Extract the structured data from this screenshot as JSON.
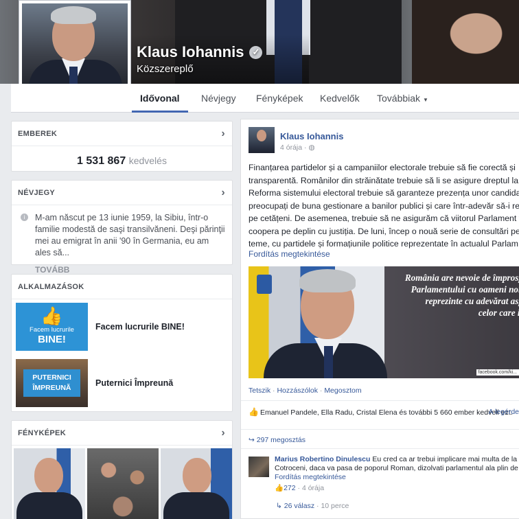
{
  "page": {
    "name": "Klaus Iohannis",
    "category": "Közszereplő"
  },
  "tabs": [
    {
      "label": "Idővonal"
    },
    {
      "label": "Névjegy"
    },
    {
      "label": "Fényképek"
    },
    {
      "label": "Kedvelők"
    },
    {
      "label": "Továbbiak"
    }
  ],
  "people": {
    "heading": "EMBEREK",
    "likes_count": "1 531 867",
    "likes_label": "kedvelés"
  },
  "about": {
    "heading": "NÉVJEGY",
    "text": "M-am născut pe 13 iunie 1959, la Sibiu, într-o familie modestă de saşi transilvăneni. Deşi părinţii mei au emigrat în anii '90 în Germania, eu am ales să...",
    "more": "TOVÁBB"
  },
  "apps": {
    "heading": "ALKALMAZÁSOK",
    "items": [
      {
        "label": "Facem lucrurile BINE!",
        "thumb_line1": "Facem lucrurile",
        "thumb_line2": "BINE!",
        "icon": "thumbs-up-icon"
      },
      {
        "label": "Puternici Împreună",
        "thumb_line1": "PUTERNICI",
        "thumb_line2": "ÎMPREUNĂ"
      }
    ]
  },
  "photos": {
    "heading": "FÉNYKÉPEK"
  },
  "post": {
    "author": "Klaus Iohannis",
    "time": "4 órája",
    "lines": [
      "Finanțarea partidelor și a campaniilor electorale trebuie să fie corectă și",
      "transparentă. Românilor din străinătate trebuie să li se asigure dreptul la",
      "Reforma sistemului electoral trebuie să garanteze prezența unor candida",
      "preocupați de buna gestionare a banilor publici și care într-adevăr să-i re",
      "pe cetățeni. De asemenea, trebuie să ne asigurăm că viitorul Parlament v",
      "coopera pe deplin cu justiția. De luni, încep o nouă serie de consultări pe",
      "teme, cu partidele și formațiunile politice reprezentate în actualul Parlam"
    ],
    "translate": "Fordítás megtekintése",
    "image_quote": [
      "România are nevoie de împrosp",
      "Parlamentului cu oameni noi,",
      "reprezinte cu adevărat asp",
      "celor care i-"
    ],
    "image_credit": "facebook.com/ki...",
    "actions": [
      "Tetszik",
      "Hozzászólok",
      "Megosztom"
    ],
    "likers": "Emanuel Pandele, Ella Radu, Cristal Elena és további 5 660 ember kedveli ezt.",
    "likers_more": "A legérde",
    "shares": "297 megosztás",
    "comment": {
      "author": "Marius Robertino Dinulescu",
      "text_line1": "Eu cred ca ar trebui implicare mai multa de la",
      "text_line2": "Cotroceni, daca va pasa de poporul Roman, dizolvati parlamentul ala plin de ho",
      "translate": "Fordítás megtekintése",
      "likes": "272",
      "time": "4 órája"
    },
    "replies": {
      "count": "26 válasz",
      "time": "10 perce"
    }
  }
}
